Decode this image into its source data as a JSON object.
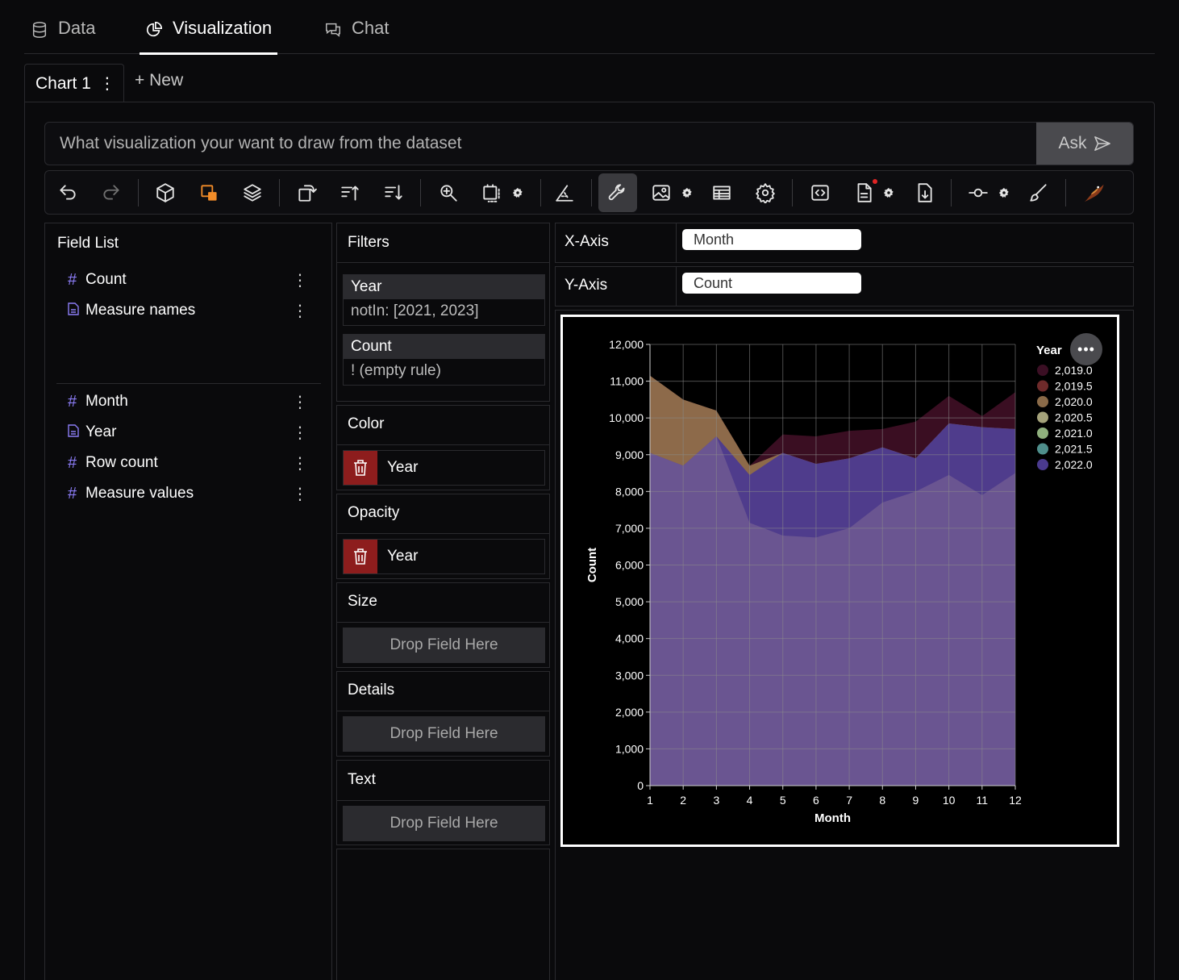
{
  "tabs": [
    {
      "label": "Data",
      "icon": "database-icon"
    },
    {
      "label": "Visualization",
      "icon": "pie-chart-icon",
      "active": true
    },
    {
      "label": "Chat",
      "icon": "chat-icon"
    }
  ],
  "chart_tabs": {
    "current": "Chart 1",
    "new_label": "+ New"
  },
  "ask": {
    "placeholder": "What visualization your want to draw from the dataset",
    "button": "Ask"
  },
  "toolbar": {
    "items": [
      "undo-icon",
      "redo-icon",
      "cube-icon",
      "geometry-icon",
      "layers-icon",
      "transpose-icon",
      "sort-ascending-icon",
      "sort-descending-icon",
      "zoom-icon",
      "resize-icon",
      "axis-icon",
      "wrench-icon",
      "image-icon",
      "table-icon",
      "settings-icon",
      "code-icon",
      "export-doc-icon",
      "download-icon",
      "line-toggle-icon",
      "brush-icon",
      "logo-icon"
    ],
    "active": "wrench-icon"
  },
  "field_list": {
    "title": "Field List",
    "dimensions": [
      {
        "name": "Count",
        "type": "measure"
      },
      {
        "name": "Measure names",
        "type": "text"
      }
    ],
    "measures": [
      {
        "name": "Month",
        "type": "measure"
      },
      {
        "name": "Year",
        "type": "text"
      },
      {
        "name": "Row count",
        "type": "measure"
      },
      {
        "name": "Measure values",
        "type": "measure"
      }
    ]
  },
  "filters": {
    "title": "Filters",
    "items": [
      {
        "field": "Year",
        "rule": "notIn: [2021, 2023]"
      },
      {
        "field": "Count",
        "rule": "! (empty rule)"
      }
    ]
  },
  "encodings": {
    "color": {
      "title": "Color",
      "field": "Year"
    },
    "opacity": {
      "title": "Opacity",
      "field": "Year"
    },
    "size": {
      "title": "Size",
      "placeholder": "Drop Field Here"
    },
    "details": {
      "title": "Details",
      "placeholder": "Drop Field Here"
    },
    "text": {
      "title": "Text",
      "placeholder": "Drop Field Here"
    }
  },
  "axes": {
    "x_label": "X-Axis",
    "x_field": "Month",
    "y_label": "Y-Axis",
    "y_field": "Count"
  },
  "chart_data": {
    "type": "area",
    "xlabel": "Month",
    "ylabel": "Count",
    "x": [
      1,
      2,
      3,
      4,
      5,
      6,
      7,
      8,
      9,
      10,
      11,
      12
    ],
    "ylim": [
      0,
      12000
    ],
    "yticks": [
      0,
      1000,
      2000,
      3000,
      4000,
      5000,
      6000,
      7000,
      8000,
      9000,
      10000,
      11000,
      12000
    ],
    "ytick_labels": [
      "0",
      "1,000",
      "2,000",
      "3,000",
      "4,000",
      "5,000",
      "6,000",
      "7,000",
      "8,000",
      "9,000",
      "10,000",
      "11,000",
      "12,000"
    ],
    "grid": true,
    "legend": {
      "title": "Year",
      "placement": "top-right",
      "entries": [
        {
          "label": "2,019.0",
          "color": "#3b0f24"
        },
        {
          "label": "2,019.5",
          "color": "#6e2a2a"
        },
        {
          "label": "2,020.0",
          "color": "#8a6a48"
        },
        {
          "label": "2,020.5",
          "color": "#a4a27a"
        },
        {
          "label": "2,021.0",
          "color": "#8fb07d"
        },
        {
          "label": "2,021.5",
          "color": "#4f8f8c"
        },
        {
          "label": "2,022.0",
          "color": "#4a3a8e"
        }
      ]
    },
    "series": [
      {
        "name": "2,019.0",
        "color": "#3a0e22",
        "values": [
          11150,
          10500,
          10200,
          8700,
          9550,
          9500,
          9650,
          9700,
          9900,
          10600,
          10050,
          10700
        ]
      },
      {
        "name": "2,020.0",
        "color": "#8d6a4a",
        "values": [
          11150,
          10500,
          10200,
          8700,
          9050,
          8750,
          8900,
          9200,
          8900,
          9850,
          9750,
          9700
        ]
      },
      {
        "name": "2,022.0",
        "color": "#4f3c8c",
        "values": [
          9050,
          8700,
          9500,
          8450,
          9050,
          8750,
          8900,
          9200,
          8900,
          9850,
          9750,
          9700
        ]
      },
      {
        "name": "2,022.0",
        "color": "#6a5591",
        "values": [
          9050,
          8700,
          9500,
          7150,
          6800,
          6750,
          7000,
          7700,
          8000,
          8450,
          7900,
          8500
        ]
      }
    ]
  }
}
